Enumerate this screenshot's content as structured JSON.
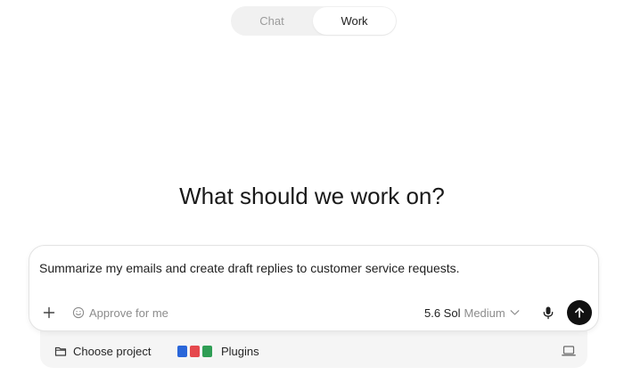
{
  "mode_toggle": {
    "chat_label": "Chat",
    "work_label": "Work",
    "active": "Work"
  },
  "heading": "What should we work on?",
  "composer": {
    "prompt_text": "Summarize my emails and create draft replies to customer service requests.",
    "approve_label": "Approve for me",
    "model_name": "5.6 Sol",
    "effort_label": "Medium",
    "icons": {
      "add": "plus-icon",
      "approve": "smiley-icon",
      "model_dropdown": "chevron-down-icon",
      "mic": "microphone-icon",
      "send": "arrow-up-icon"
    }
  },
  "tray": {
    "project_label": "Choose project",
    "plugins_label": "Plugins",
    "plugin_icon_colors": [
      "#2a66d9",
      "#e5484d",
      "#2f9e55"
    ],
    "icons": {
      "project": "folder-icon",
      "device": "laptop-icon"
    }
  },
  "colors": {
    "send_button": "#111111",
    "toggle_bg": "#f1f1f1",
    "tray_bg": "#f5f5f5"
  }
}
